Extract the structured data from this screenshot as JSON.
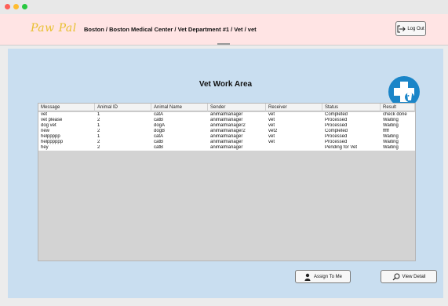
{
  "app": {
    "logo_text": "Paw Pal",
    "breadcrumb": "Boston / Boston Medical Center / Vet Department #1 / Vet / vet",
    "logout_label": "Log Out"
  },
  "main": {
    "title": "Vet Work Area",
    "logo_icon": "vet-cross-icon",
    "assign_label": "Assign To Me",
    "assign_icon": "person-icon",
    "view_detail_label": "View Detail",
    "view_detail_icon": "magnifier-icon"
  },
  "table": {
    "columns": [
      "Message",
      "Animal ID",
      "Animal Name",
      "Sender",
      "Receiver",
      "Status",
      "Result"
    ],
    "rows": [
      [
        "vet",
        "1",
        "catA",
        "animalmanager",
        "vet",
        "Completed",
        "check done"
      ],
      [
        "vet please",
        "2",
        "catB",
        "animalmanager",
        "vet",
        "Processed",
        "Waiting"
      ],
      [
        "dog vet",
        "1",
        "dogA",
        "animalmanager2",
        "vet",
        "Processed",
        "Waiting"
      ],
      [
        "new",
        "2",
        "dogB",
        "animalmanager2",
        "vet2",
        "Completed",
        "fffff"
      ],
      [
        "helppppp",
        "1",
        "catA",
        "animalmanager",
        "vet",
        "Processed",
        "Waiting"
      ],
      [
        "helpppppp",
        "2",
        "catB",
        "animalmanager",
        "vet",
        "Processed",
        "Waiting"
      ],
      [
        "hey",
        "2",
        "catB",
        "animalmanager",
        "",
        "Pending for Vet",
        "Waiting"
      ]
    ]
  },
  "colors": {
    "header_bg": "#ffe4e4",
    "content_bg": "#c9def0",
    "logo_text": "#e8c030",
    "vet_logo_bg": "#1a85c8"
  }
}
